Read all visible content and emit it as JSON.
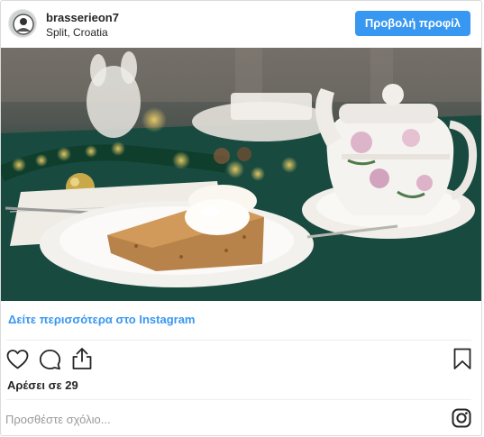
{
  "header": {
    "username": "brasserieon7",
    "location": "Split, Croatia",
    "profile_button": "Προβολή προφίλ"
  },
  "post": {
    "see_more_link": "Δείτε περισσότερα στο Instagram",
    "likes_text": "Αρέσει σε 29",
    "comment_placeholder": "Προσθέστε σχόλιο..."
  },
  "icons": {
    "like": "heart-icon",
    "comment": "comment-bubble-icon",
    "share": "share-icon",
    "save": "bookmark-icon",
    "brand": "instagram-logo-icon"
  },
  "colors": {
    "accent": "#3897f0",
    "text": "#262626",
    "placeholder": "#999999"
  }
}
